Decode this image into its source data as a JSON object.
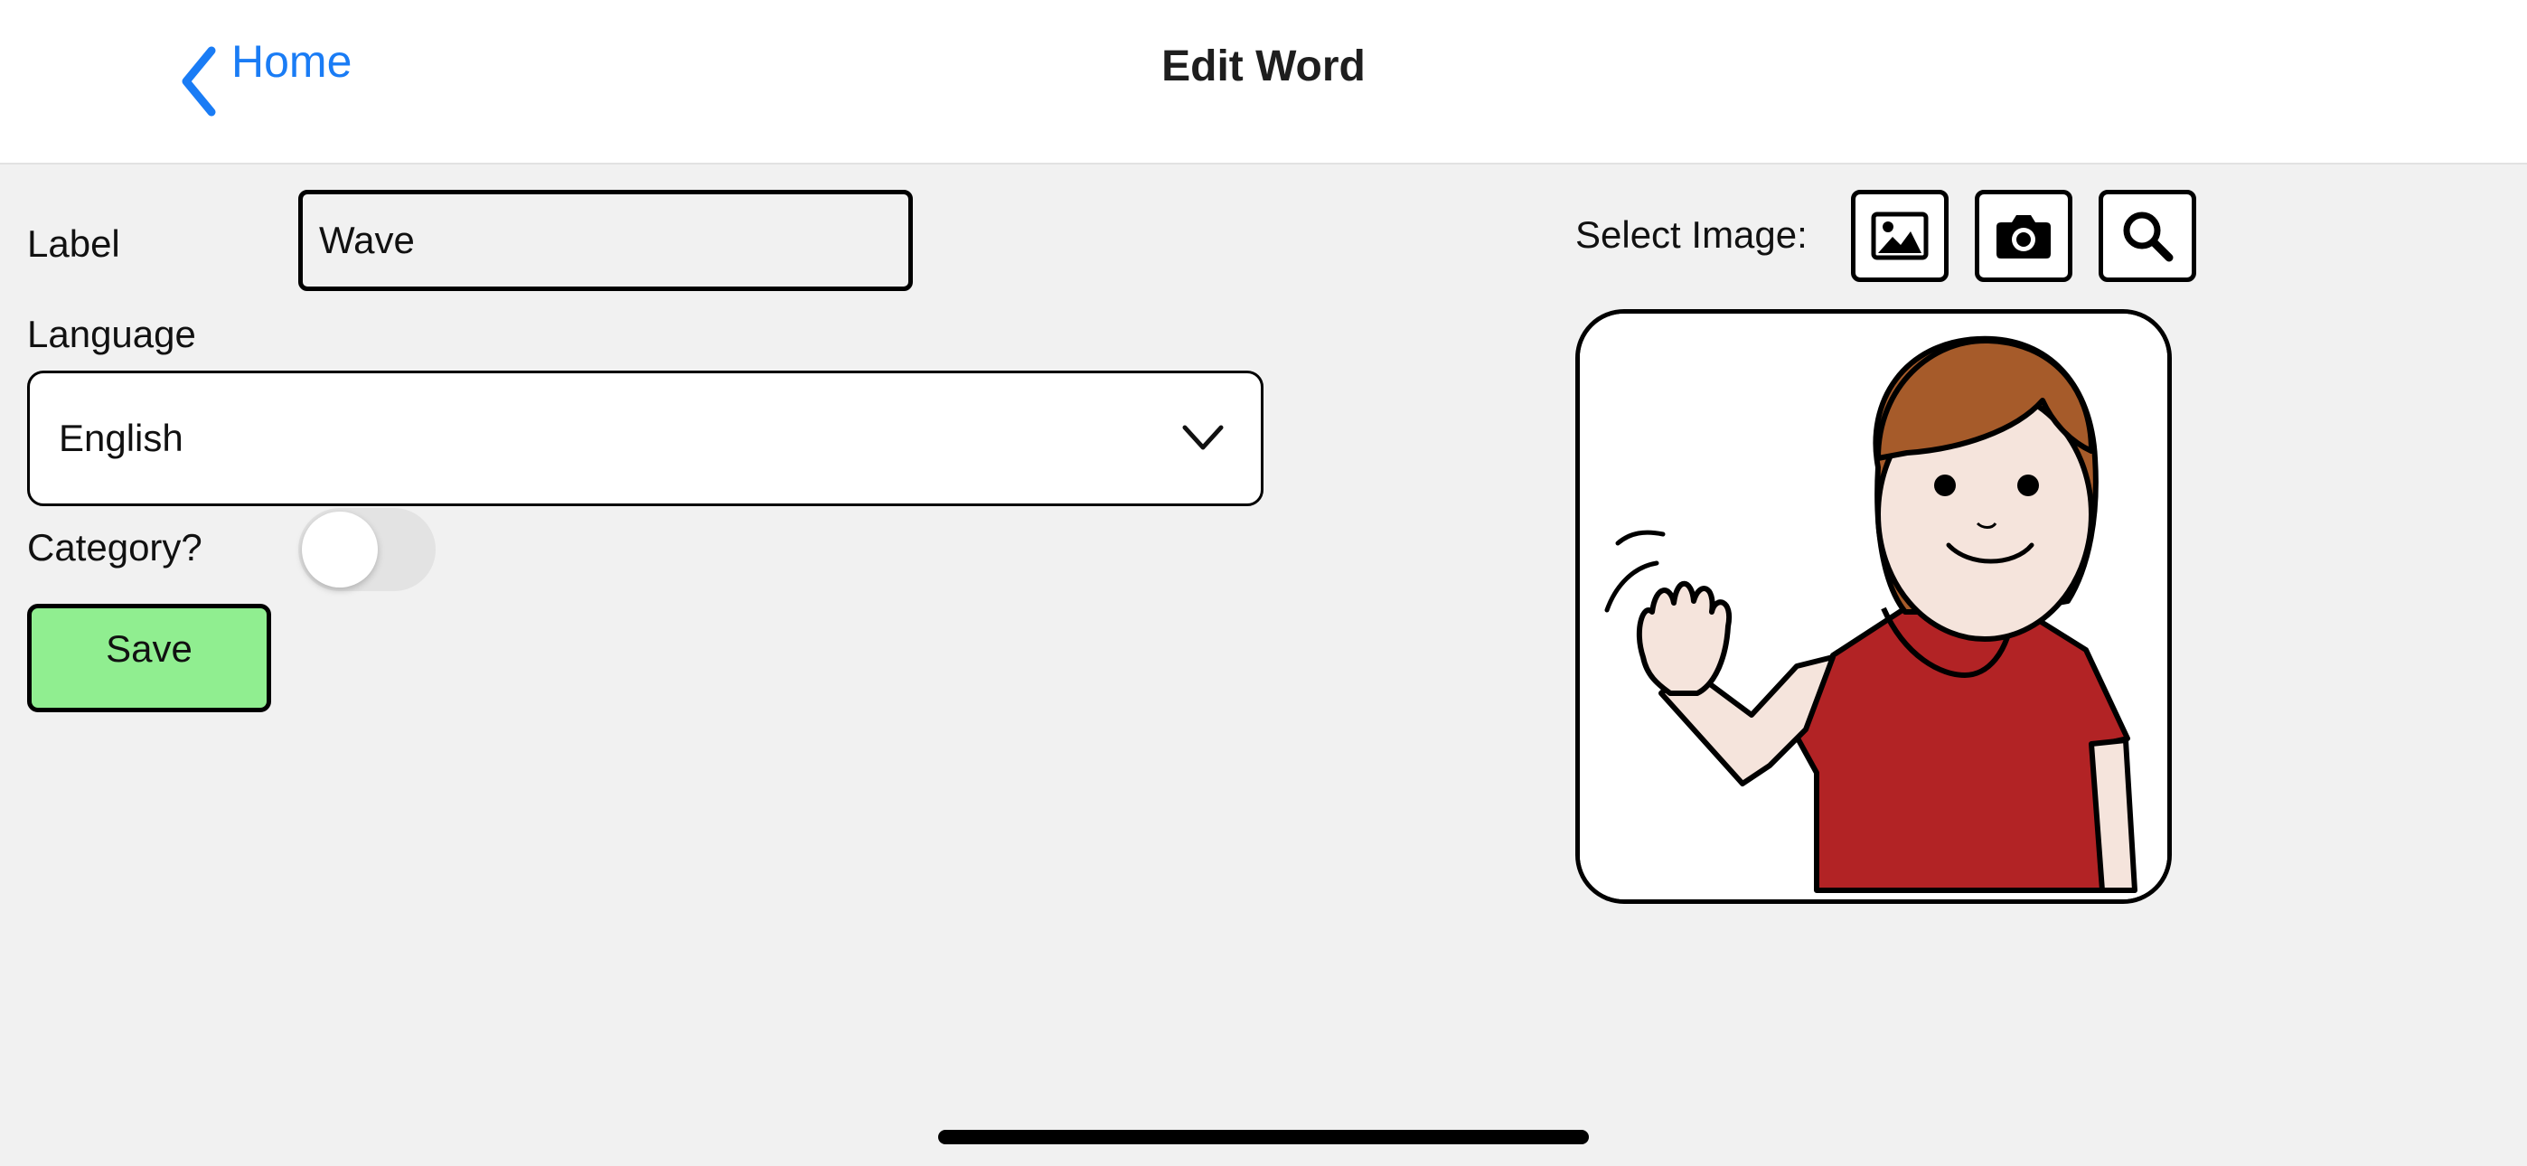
{
  "navbar": {
    "back_label": "Home",
    "title": "Edit Word",
    "accent_color": "#1a7cf5"
  },
  "form": {
    "label_field_label": "Label",
    "label_value": "Wave",
    "language_label": "Language",
    "language_value": "English",
    "category_label": "Category?",
    "category_on": false,
    "save_label": "Save",
    "save_color": "#90ee90"
  },
  "image_panel": {
    "select_image_label": "Select Image:",
    "buttons": [
      {
        "icon": "photo-library-icon"
      },
      {
        "icon": "camera-icon"
      },
      {
        "icon": "search-icon"
      }
    ],
    "preview_subject": "wave-symbol-picture"
  }
}
